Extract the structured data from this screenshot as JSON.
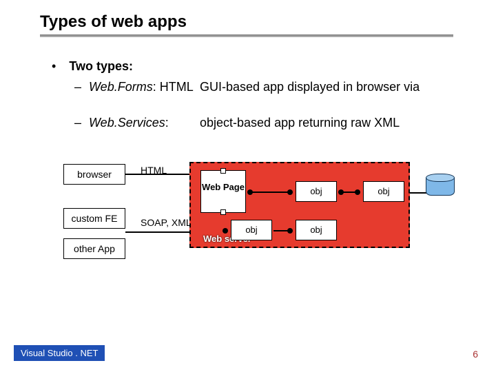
{
  "title": "Types of web apps",
  "bullets": {
    "two_types": "Two types:",
    "webforms_name": "Web.Forms",
    "webforms_suffix": ": HTML",
    "webforms_desc": "GUI-based app displayed in browser via",
    "webservices_name": "Web.Services",
    "webservices_suffix": ":",
    "webservices_desc": "object-based app returning raw XML"
  },
  "diagram": {
    "clients": {
      "browser": "browser",
      "custom_fe": "custom FE",
      "other_app": "other App"
    },
    "protocols": {
      "html": "HTML",
      "soap_xml": "SOAP, XML"
    },
    "server_label": "Web server",
    "web_page": "Web Page",
    "obj": "obj"
  },
  "footer": {
    "product": "Visual Studio . NET",
    "page": "6"
  }
}
